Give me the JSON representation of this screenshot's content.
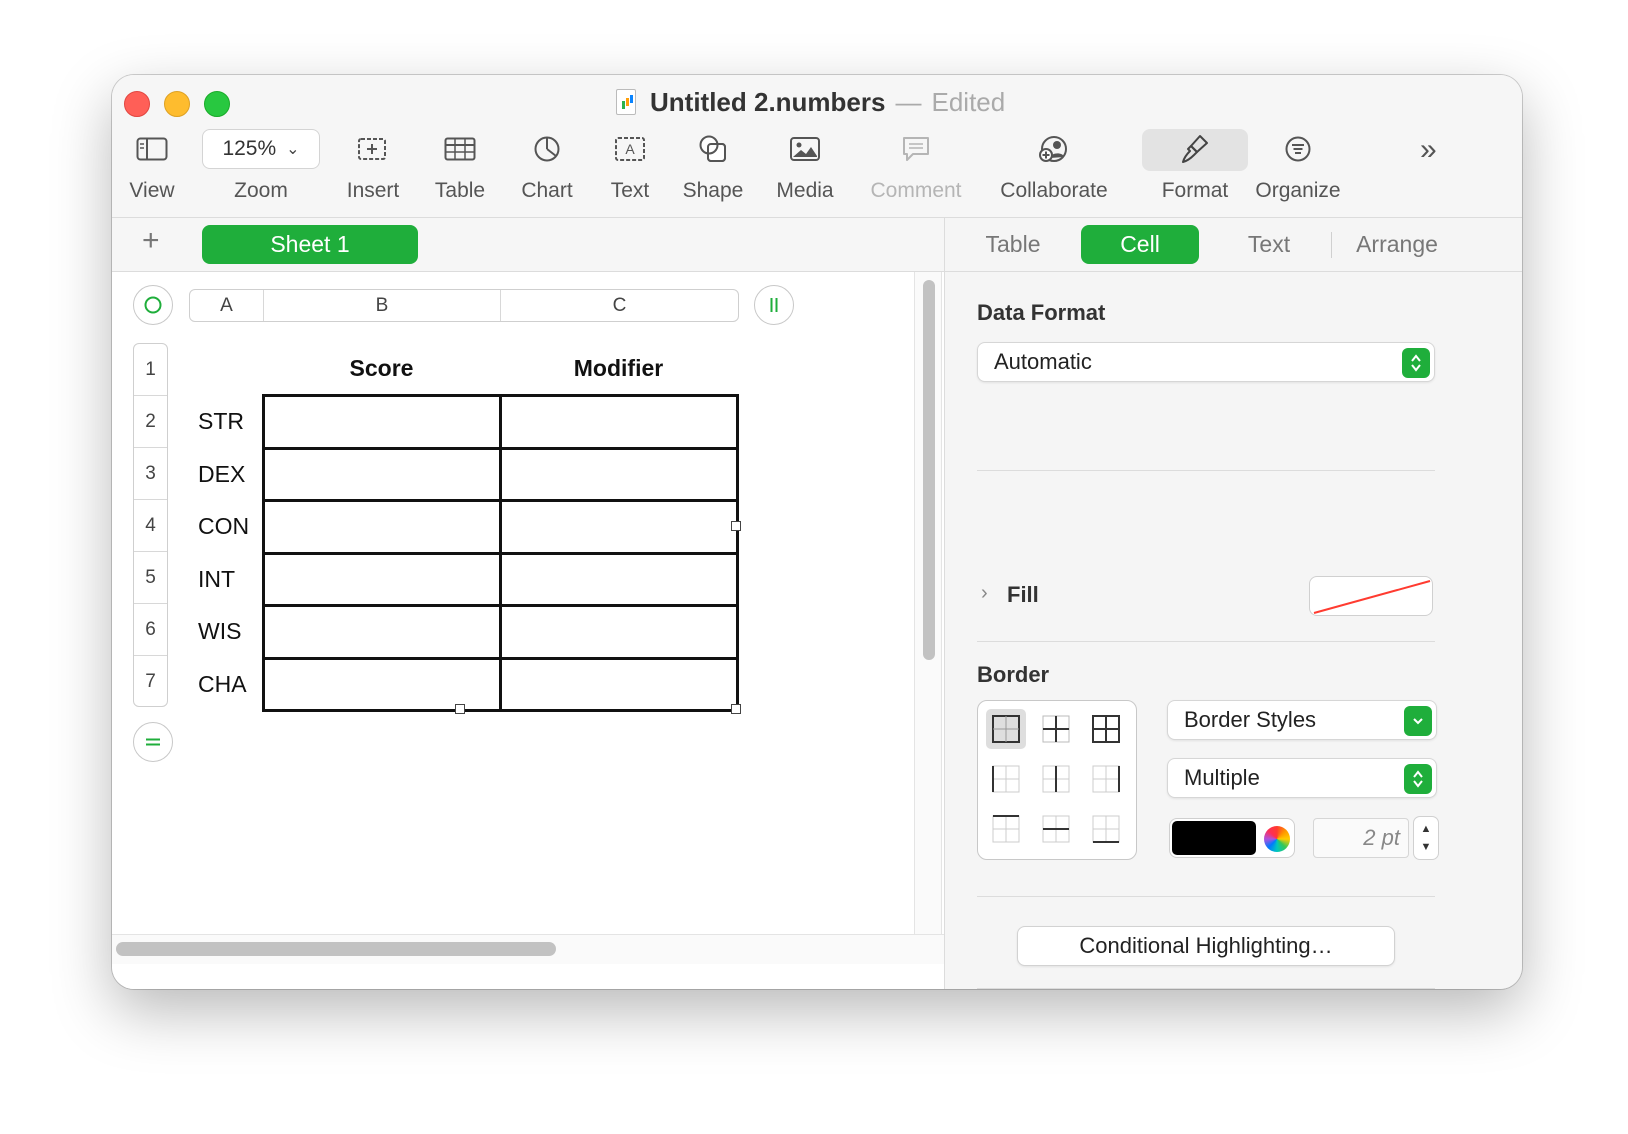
{
  "window": {
    "doc_name": "Untitled 2.numbers",
    "separator": "—",
    "status": "Edited"
  },
  "toolbar": {
    "view_label": "View",
    "zoom_value": "125%",
    "zoom_label": "Zoom",
    "insert_label": "Insert",
    "table_label": "Table",
    "chart_label": "Chart",
    "text_label": "Text",
    "shape_label": "Shape",
    "media_label": "Media",
    "comment_label": "Comment",
    "collaborate_label": "Collaborate",
    "format_label": "Format",
    "organize_label": "Organize",
    "overflow": "»"
  },
  "sheets": {
    "add": "+",
    "tabs": [
      "Sheet 1"
    ]
  },
  "table": {
    "column_headers": [
      "A",
      "B",
      "C"
    ],
    "row_numbers": [
      "1",
      "2",
      "3",
      "4",
      "5",
      "6",
      "7"
    ],
    "header_row": [
      "",
      "Score",
      "Modifier"
    ],
    "rows": [
      [
        "STR",
        "",
        ""
      ],
      [
        "DEX",
        "",
        ""
      ],
      [
        "CON",
        "",
        ""
      ],
      [
        "INT",
        "",
        ""
      ],
      [
        "WIS",
        "",
        ""
      ],
      [
        "CHA",
        "",
        ""
      ]
    ]
  },
  "inspector": {
    "tabs": [
      "Table",
      "Cell",
      "Text",
      "Arrange"
    ],
    "active_tab": "Cell",
    "data_format": {
      "title": "Data Format",
      "value": "Automatic"
    },
    "fill": {
      "label": "Fill",
      "value": "none"
    },
    "border": {
      "title": "Border",
      "styles_value": "Border Styles",
      "type_value": "Multiple",
      "color": "#000000",
      "width_value": "2 pt"
    },
    "conditional_button": "Conditional Highlighting…"
  },
  "colors": {
    "accent": "#1fae3b",
    "close": "#ff5f57",
    "minimize": "#febc2e",
    "zoom": "#28c840"
  }
}
